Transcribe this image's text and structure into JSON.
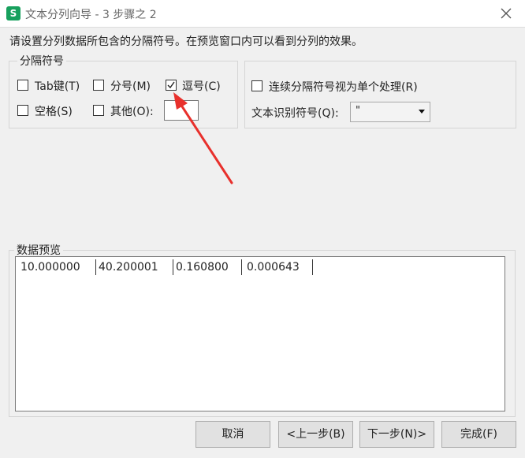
{
  "window": {
    "app_icon_letter": "S",
    "title": "文本分列向导 - 3 步骤之 2",
    "close_icon": "close-icon"
  },
  "instruction": "请设置分列数据所包含的分隔符号。在预览窗口内可以看到分列的效果。",
  "delimiters": {
    "legend": "分隔符号",
    "tab": {
      "label": "Tab键(T)",
      "checked": false
    },
    "semicolon": {
      "label": "分号(M)",
      "checked": false
    },
    "comma": {
      "label": "逗号(C)",
      "checked": true
    },
    "space": {
      "label": "空格(S)",
      "checked": false
    },
    "other": {
      "label": "其他(O):",
      "checked": false,
      "value": ""
    }
  },
  "options": {
    "consecutive": {
      "label": "连续分隔符号视为单个处理(R)",
      "checked": false
    },
    "qualifier_label": "文本识别符号(Q):",
    "qualifier_value": "\""
  },
  "preview": {
    "legend": "数据预览",
    "cells": [
      "10.000000",
      "40.200001",
      "0.160800",
      "0.000643"
    ]
  },
  "buttons": {
    "cancel": "取消",
    "back": "<上一步(B)",
    "next": "下一步(N)>",
    "finish": "完成(F)"
  },
  "annotation": {
    "arrow_color": "#e8302c"
  }
}
